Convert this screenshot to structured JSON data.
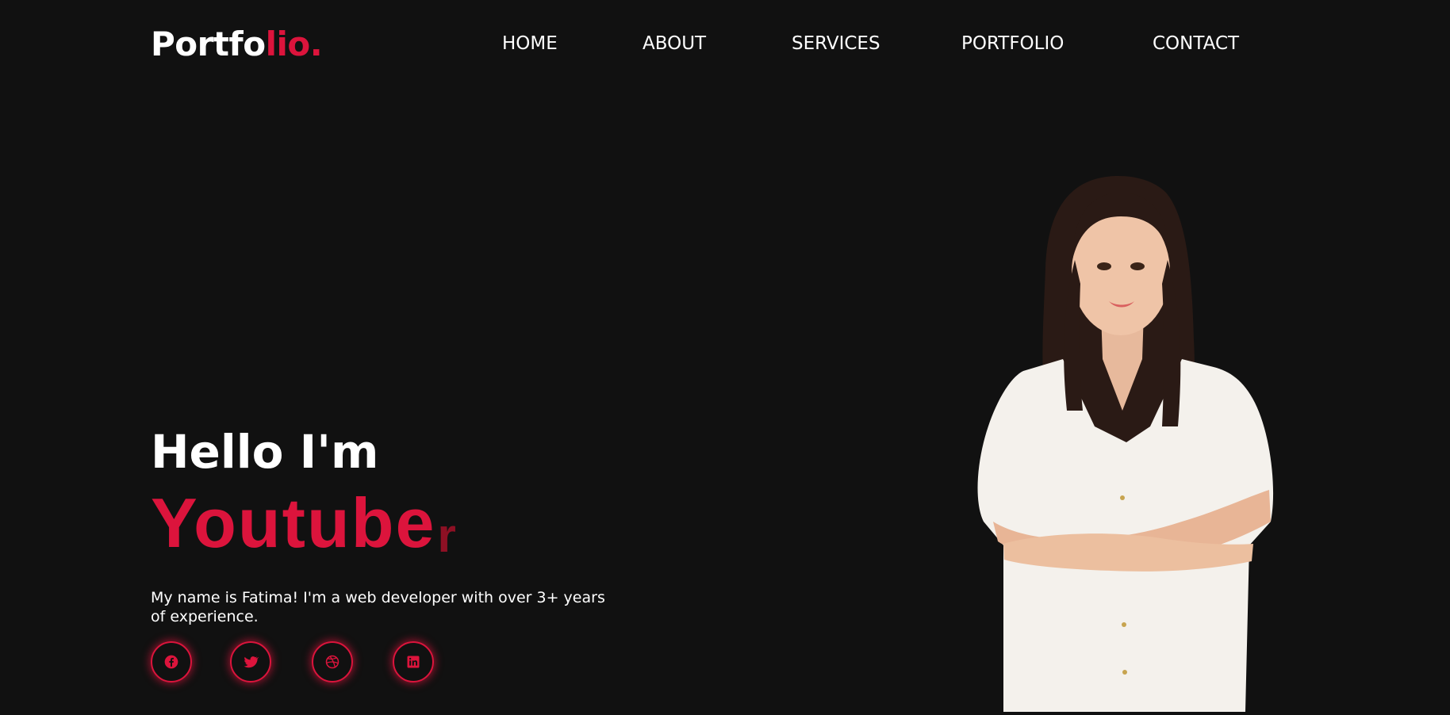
{
  "logo": {
    "part1": "Portfo",
    "part2": "lio."
  },
  "nav": {
    "home": "HOME",
    "about": "ABOUT",
    "services": "SERVICES",
    "portfolio": "PORTFOLIO",
    "contact": "CONTACT"
  },
  "hero": {
    "greeting": "Hello I'm",
    "role_main": "Youtube",
    "role_cursor": "r",
    "intro": "My name is Fatima! I'm a web developer with over 3+ years of experience."
  },
  "socials": [
    {
      "icon": "facebook-icon"
    },
    {
      "icon": "twitter-icon"
    },
    {
      "icon": "dribbble-icon"
    },
    {
      "icon": "linkedin-icon"
    }
  ],
  "colors": {
    "background": "#111111",
    "accent": "#dc143c",
    "text": "#ffffff"
  }
}
